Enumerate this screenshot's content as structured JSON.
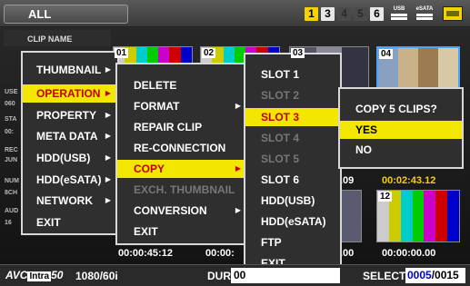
{
  "top": {
    "mode": "ALL",
    "slots": [
      {
        "label": "1",
        "state": "active"
      },
      {
        "label": "3",
        "state": "on"
      },
      {
        "label": "4",
        "state": "off"
      },
      {
        "label": "5",
        "state": "off"
      },
      {
        "label": "6",
        "state": "on"
      }
    ],
    "ports": [
      "USB",
      "eSATA"
    ]
  },
  "list": {
    "clip_name_header": "CLIP NAME",
    "side_info": [
      "USE",
      "060",
      "STA",
      "00:",
      "REC",
      "JUN",
      "NUM",
      "8CH",
      "AUD",
      "16"
    ]
  },
  "thumbnails": [
    {
      "num": "01"
    },
    {
      "num": "02"
    },
    {
      "num": "03"
    },
    {
      "num": "04"
    },
    {
      "num": "12"
    }
  ],
  "timecodes": {
    "tc1": "00:00:45:12",
    "tc2": "00:00:",
    "tc3": ".00",
    "tc4": "00:00:00.00",
    "tc_hl": "00:02:43.12",
    "tc_hl_prefix": ".09"
  },
  "menu_main": {
    "items": [
      {
        "label": "THUMBNAIL",
        "arrow": "▶",
        "state": "normal"
      },
      {
        "label": "OPERATION",
        "arrow": "▶",
        "state": "selected"
      },
      {
        "label": "PROPERTY",
        "arrow": "▶",
        "state": "normal"
      },
      {
        "label": "META DATA",
        "arrow": "▶",
        "state": "normal"
      },
      {
        "label": "HDD(USB)",
        "arrow": "▶",
        "state": "normal"
      },
      {
        "label": "HDD(eSATA)",
        "arrow": "▶",
        "state": "normal"
      },
      {
        "label": "NETWORK",
        "arrow": "▶",
        "state": "normal"
      },
      {
        "label": "EXIT",
        "arrow": "",
        "state": "normal"
      }
    ]
  },
  "menu_operation": {
    "items": [
      {
        "label": "DELETE",
        "arrow": "",
        "state": "normal"
      },
      {
        "label": "FORMAT",
        "arrow": "▶",
        "state": "normal"
      },
      {
        "label": "REPAIR CLIP",
        "arrow": "",
        "state": "normal"
      },
      {
        "label": "RE-CONNECTION",
        "arrow": "",
        "state": "normal"
      },
      {
        "label": "COPY",
        "arrow": "▶",
        "state": "selected"
      },
      {
        "label": "EXCH. THUMBNAIL",
        "arrow": "",
        "state": "disabled"
      },
      {
        "label": "CONVERSION",
        "arrow": "▶",
        "state": "normal"
      },
      {
        "label": "EXIT",
        "arrow": "",
        "state": "normal"
      }
    ]
  },
  "menu_copy": {
    "items": [
      {
        "label": "SLOT 1",
        "state": "normal"
      },
      {
        "label": "SLOT 2",
        "state": "disabled"
      },
      {
        "label": "SLOT 3",
        "state": "selected"
      },
      {
        "label": "SLOT 4",
        "state": "disabled"
      },
      {
        "label": "SLOT 5",
        "state": "disabled"
      },
      {
        "label": "SLOT 6",
        "state": "normal"
      },
      {
        "label": "HDD(USB)",
        "state": "normal"
      },
      {
        "label": "HDD(eSATA)",
        "state": "normal"
      },
      {
        "label": "FTP",
        "state": "normal"
      },
      {
        "label": "EXIT",
        "state": "normal"
      }
    ]
  },
  "confirm": {
    "question": "COPY 5 CLIPS?",
    "yes": "YES",
    "no": "NO"
  },
  "bottom": {
    "format_logo": "AVC",
    "format_intra": "Intra",
    "format_rate": "50",
    "format": "1080/60i",
    "dur_label": "DUR",
    "dur_value": "00",
    "select_label": "SELECT",
    "select_current": "0005",
    "select_total": "/0015"
  },
  "colors": {
    "highlight": "#f3e600",
    "selected_text": "#c00000",
    "menu_bg": "#2f2f2f",
    "menu_border": "#d8d8d8",
    "slot_active": "#f3d400",
    "selection_frame": "#4aa3ff"
  }
}
